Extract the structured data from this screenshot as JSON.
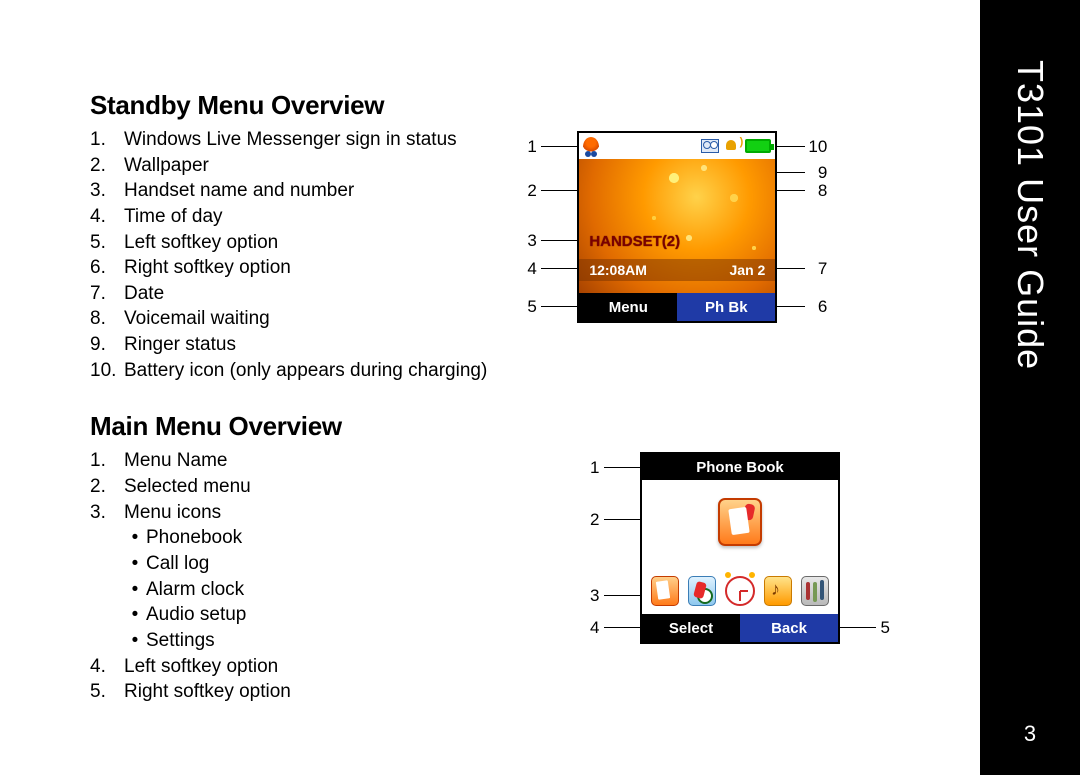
{
  "side_tab": {
    "title": "T3101 User Guide",
    "page_number": "3"
  },
  "standby": {
    "heading": "Standby Menu Overview",
    "items": [
      "Windows Live Messenger sign in status",
      "Wallpaper",
      "Handset name and number",
      "Time of day",
      "Left softkey option",
      "Right softkey option",
      "Date",
      "Voicemail waiting",
      "Ringer status",
      "Battery icon (only appears during charging)"
    ],
    "screen": {
      "handset_label": "HANDSET(2)",
      "time": "12:08AM",
      "date": "Jan 2",
      "left_softkey": "Menu",
      "right_softkey": "Ph Bk"
    },
    "callouts_left": [
      "1",
      "2",
      "3",
      "4",
      "5"
    ],
    "callouts_right": [
      "10",
      "9",
      "8",
      "7",
      "6"
    ]
  },
  "mainmenu": {
    "heading": "Main Menu Overview",
    "items": [
      "Menu Name",
      "Selected menu",
      "Menu icons",
      "Left softkey option",
      "Right softkey option"
    ],
    "icons": [
      "Phonebook",
      "Call log",
      "Alarm clock",
      "Audio setup",
      "Settings"
    ],
    "screen": {
      "title": "Phone Book",
      "left_softkey": "Select",
      "right_softkey": "Back"
    },
    "callouts_left": [
      "1",
      "2",
      "3",
      "4"
    ],
    "callouts_right": [
      "5"
    ]
  }
}
